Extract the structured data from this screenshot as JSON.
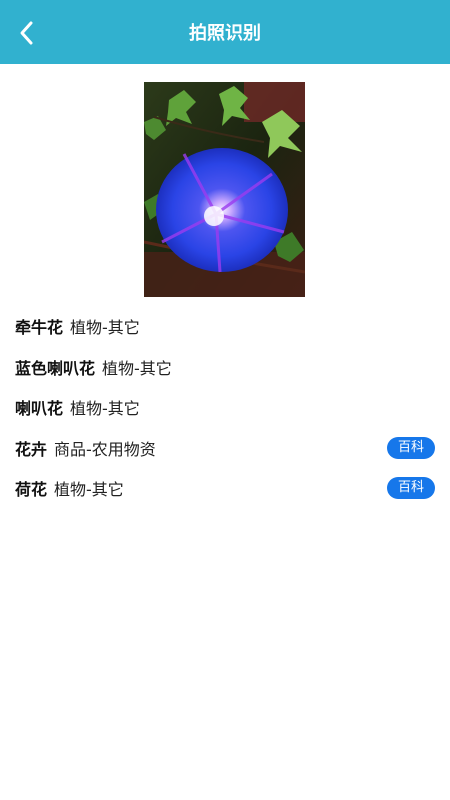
{
  "header": {
    "title": "拍照识别",
    "back_icon": "chevron-left-icon",
    "background_color": "#31b1cf"
  },
  "results": [
    {
      "name": "牵牛花",
      "category": "植物-其它",
      "baike_label": ""
    },
    {
      "name": "蓝色喇叭花",
      "category": "植物-其它",
      "baike_label": ""
    },
    {
      "name": "喇叭花",
      "category": "植物-其它",
      "baike_label": ""
    },
    {
      "name": "花卉",
      "category": "商品-农用物资",
      "baike_label": "百科"
    },
    {
      "name": "荷花",
      "category": "植物-其它",
      "baike_label": "百科"
    }
  ],
  "colors": {
    "accent": "#1677ea",
    "header": "#31b1cf"
  }
}
